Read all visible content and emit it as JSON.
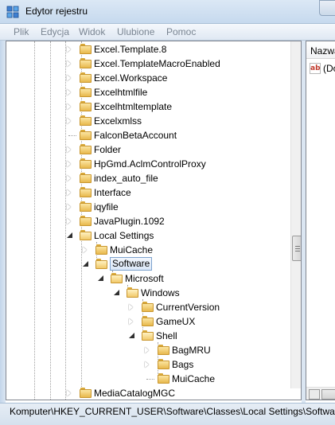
{
  "window": {
    "title": "Edytor rejestru"
  },
  "menu": [
    "Plik",
    "Edycja",
    "Widok",
    "Ulubione",
    "Pomoc"
  ],
  "tree": {
    "items": [
      {
        "label": "Excel.Template.8",
        "expander": "closed",
        "selected": false
      },
      {
        "label": "Excel.TemplateMacroEnabled",
        "expander": "closed",
        "selected": false
      },
      {
        "label": "Excel.Workspace",
        "expander": "closed",
        "selected": false
      },
      {
        "label": "Excelhtmlfile",
        "expander": "closed",
        "selected": false
      },
      {
        "label": "Excelhtmltemplate",
        "expander": "closed",
        "selected": false
      },
      {
        "label": "Excelxmlss",
        "expander": "closed",
        "selected": false
      },
      {
        "label": "FalconBetaAccount",
        "expander": "none",
        "selected": false
      },
      {
        "label": "Folder",
        "expander": "closed",
        "selected": false
      },
      {
        "label": "HpGmd.AclmControlProxy",
        "expander": "closed",
        "selected": false
      },
      {
        "label": "index_auto_file",
        "expander": "closed",
        "selected": false
      },
      {
        "label": "Interface",
        "expander": "closed",
        "selected": false
      },
      {
        "label": "iqyfile",
        "expander": "closed",
        "selected": false
      },
      {
        "label": "JavaPlugin.1092",
        "expander": "closed",
        "selected": false
      },
      {
        "label": "Local Settings",
        "expander": "open",
        "selected": false
      },
      {
        "label": "MuiCache",
        "expander": "closed",
        "selected": false
      },
      {
        "label": "Software",
        "expander": "open",
        "selected": true
      },
      {
        "label": "Microsoft",
        "expander": "open",
        "selected": false
      },
      {
        "label": "Windows",
        "expander": "open",
        "selected": false
      },
      {
        "label": "CurrentVersion",
        "expander": "closed",
        "selected": false
      },
      {
        "label": "GameUX",
        "expander": "closed",
        "selected": false
      },
      {
        "label": "Shell",
        "expander": "open",
        "selected": false
      },
      {
        "label": "BagMRU",
        "expander": "closed",
        "selected": false
      },
      {
        "label": "Bags",
        "expander": "closed",
        "selected": false
      },
      {
        "label": "MuiCache",
        "expander": "none",
        "selected": false
      },
      {
        "label": "MediaCatalogMGC",
        "expander": "closed",
        "selected": false
      }
    ]
  },
  "right_pane": {
    "column_header": "Nazwa",
    "value_icon": "string-value-icon",
    "value_icon_text": "ab",
    "value_name": "(Domyślna)"
  },
  "status": {
    "path": "Komputer\\HKEY_CURRENT_USER\\Software\\Classes\\Local Settings\\Software"
  }
}
